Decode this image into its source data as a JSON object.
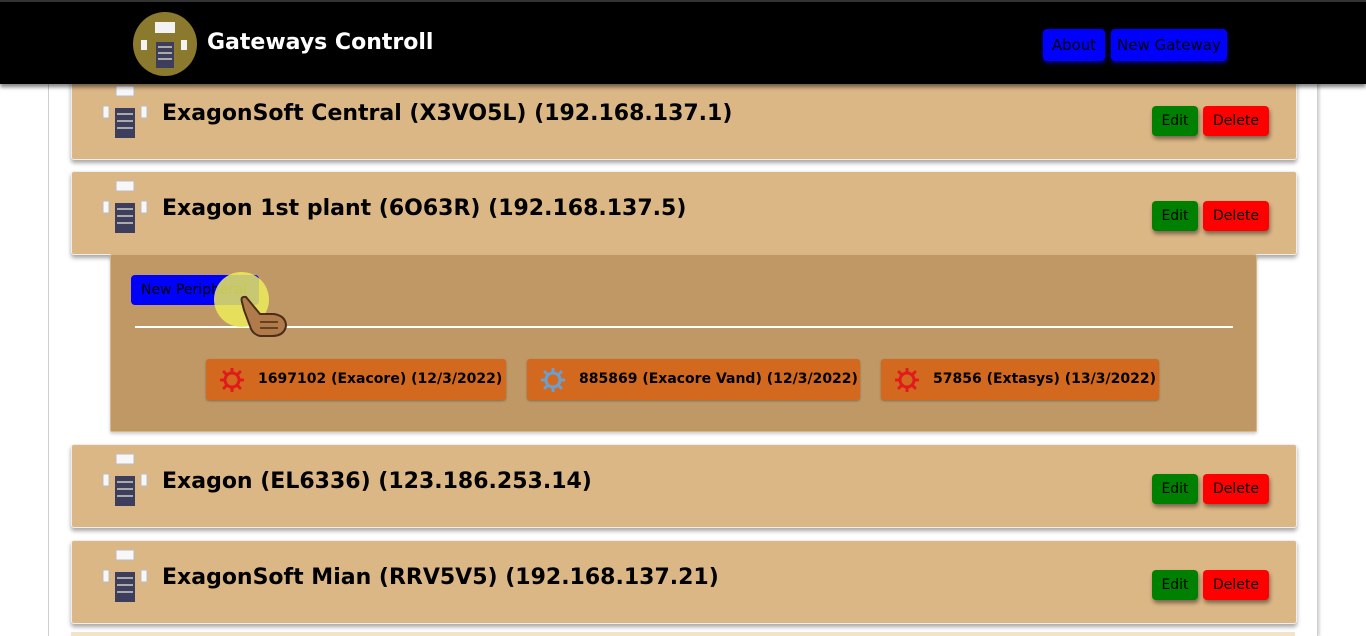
{
  "navbar": {
    "title": "Gateways Controll",
    "about_label": "About",
    "new_gateway_label": "New Gateway"
  },
  "gateways": [
    {
      "title": "ExagonSoft Central (X3VO5L) (192.168.137.1)",
      "edit_label": "Edit",
      "delete_label": "Delete"
    },
    {
      "title": "Exagon 1st plant (6O63R) (192.168.137.5)",
      "edit_label": "Edit",
      "delete_label": "Delete"
    },
    {
      "title": "Exagon (EL6336) (123.186.253.14)",
      "edit_label": "Edit",
      "delete_label": "Delete"
    },
    {
      "title": "ExagonSoft Mian (RRV5V5) (192.168.137.21)",
      "edit_label": "Edit",
      "delete_label": "Delete"
    }
  ],
  "peripherals": {
    "new_label": "New Peripheral",
    "items": [
      {
        "label": "1697102 (Exacore) (12/3/2022)",
        "icon": "gear-icon",
        "status_color": "#e01b1b"
      },
      {
        "label": "885869 (Exacore Vand) (12/3/2022)",
        "icon": "gear-icon",
        "status_color": "#6b9fd0"
      },
      {
        "label": "57856 (Extasys) (13/3/2022)",
        "icon": "gear-icon",
        "status_color": "#e01b1b"
      }
    ]
  },
  "colors": {
    "navbar": "#000000",
    "card": "#dcb786",
    "panel": "#bf9866",
    "chip": "#d2691e",
    "edit": "#008000",
    "delete": "#ff0000",
    "primary": "#0000ff"
  }
}
